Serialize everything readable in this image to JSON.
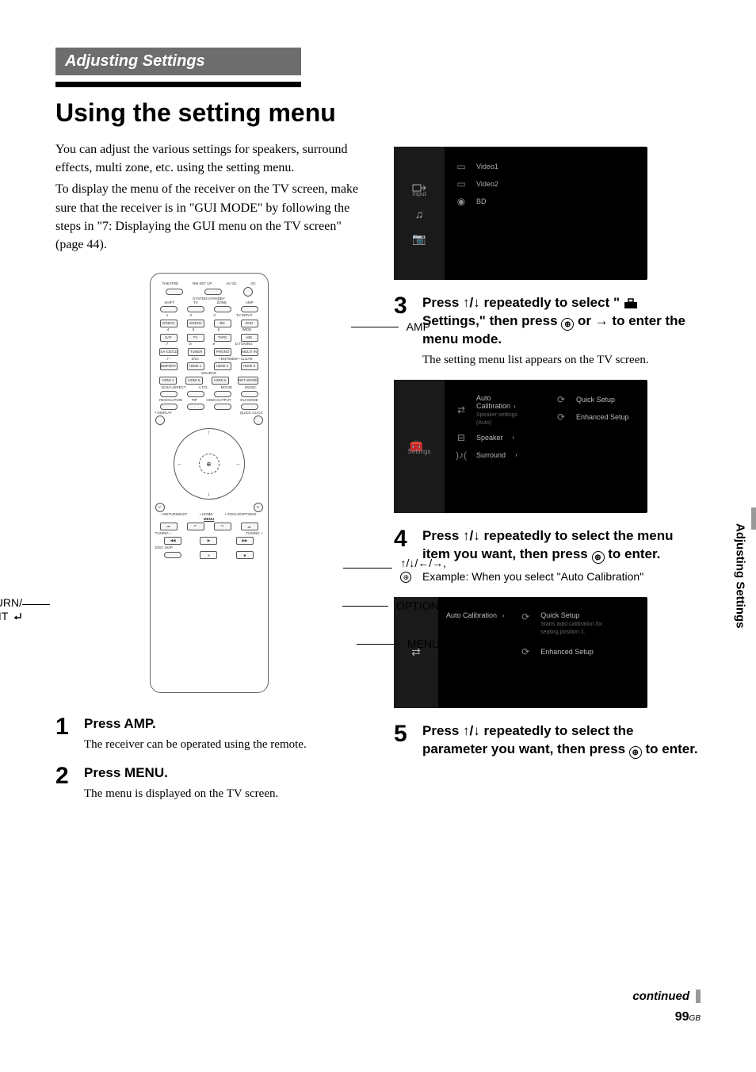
{
  "section_banner": "Adjusting Settings",
  "title": "Using the setting menu",
  "intro": "You can adjust the various settings for speakers, surround effects, multi zone, etc. using the setting menu.",
  "intro2": "To display the menu of the receiver on the TV screen, make sure that the receiver is in \"GUI MODE\" by following the steps in \"7: Displaying the GUI menu on the TV screen\" (page 44).",
  "remote": {
    "top_row": [
      "THEATRE",
      "RM SET UP",
      "AV I/⏻",
      "I/⏻"
    ],
    "system_standby": "SYSTEM STANDBY",
    "mode_row": [
      "SHIFT",
      "TV",
      "ZONE",
      "AMP"
    ],
    "row_num1": [
      ".1",
      ".2",
      ".3"
    ],
    "row_num1_rt": "TV INPUT",
    "rowA": [
      "VIDEO1",
      "VIDEO2",
      "BD"
    ],
    "rowA_rt": "DVD",
    "row_num2": [
      ".4",
      ".5",
      ".6"
    ],
    "row_num2_rt": "WIDE",
    "rowB": [
      "SAT",
      "TV",
      "TAPE"
    ],
    "rowB_rt": "MD",
    "row_num3": [
      ".7",
      ".8",
      ".9"
    ],
    "row_num3_rt": "D.TUNING",
    "rowC": [
      "SA-CD/CD",
      "TUNER",
      "PHONO"
    ],
    "rowC_rt": "MULTI IN",
    "rowD_pre": ".-/--",
    "rowD_center": ".0/10",
    "rowD_label": "• ENT/MEM  • CLEAR",
    "rowE": [
      "DMPORT",
      "HDMI 1",
      "HDMI 2"
    ],
    "rowE_rt": "HDMI 3",
    "source": "SOURCE",
    "rowF": [
      "HDMI 4",
      "HDMI 5",
      "HDMI 6"
    ],
    "rowF_rt": "NET-WORK",
    "rowG": [
      "2CH/A.DIRECT",
      "A.F.D.",
      "MOVIE",
      "MUSIC"
    ],
    "rowH": [
      "RESOLUTION",
      "PIP",
      "HDMI OUTPUT",
      "GUI MODE"
    ],
    "display": "• DISPLAY",
    "quick_click": "QUICK CLICK",
    "below_labels": [
      "• RETURN/EXIT",
      "• HOME",
      "• TOOLS/OPTIONS"
    ],
    "menu_label": "MENU",
    "tuning_minus": "TUNING –",
    "tuning_plus": "TUNING +",
    "disc_skip": "DISC SKIP",
    "callouts": {
      "amp": "AMP",
      "arrows": "↑/↓/←/→,",
      "options": "OPTIONS",
      "menu": "MENU",
      "return1": "RETURN/",
      "return2": "EXIT "
    }
  },
  "steps": {
    "s1": {
      "title": "Press AMP.",
      "text": "The receiver can be operated using the remote."
    },
    "s2": {
      "title": "Press MENU.",
      "text": "The menu is displayed on the TV screen."
    },
    "s3": {
      "title_pre": "Press ",
      "title_arrows": "↑/↓",
      "title_mid": " repeatedly to select \"",
      "title_icon_label": "Settings",
      "title_mid2": ",\" then press ",
      "title_post": " or → to enter the menu mode.",
      "text": "The setting menu list appears on the TV screen."
    },
    "s4": {
      "title_pre": "Press ",
      "title_arrows": "↑/↓",
      "title_mid": " repeatedly to select the menu item you want, then press ",
      "title_post": " to enter."
    },
    "s5": {
      "title_pre": "Press ",
      "title_arrows": "↑/↓",
      "title_mid": " repeatedly to select the parameter you want, then press ",
      "title_post": " to enter."
    }
  },
  "tv1": {
    "sidebar_selected_label": "Input",
    "items": [
      {
        "icon": "▭",
        "label": "Video1"
      },
      {
        "icon": "▭",
        "label": "Video2"
      },
      {
        "icon": "◉",
        "label": "BD"
      }
    ]
  },
  "tv2": {
    "sidebar_label": "Settings",
    "left_items": [
      {
        "icon": "⇄",
        "label": "Auto Calibration",
        "sub": "Speaker settings (Auto)",
        "chev": "›"
      },
      {
        "icon": "⊟",
        "label": "Speaker",
        "chev": "›"
      },
      {
        "icon": "♪",
        "label": "Surround",
        "chev": "›"
      }
    ],
    "right_items": [
      {
        "icon": "⟳",
        "label": "Quick Setup"
      },
      {
        "icon": "⟳",
        "label": "Enhanced Setup"
      }
    ]
  },
  "example_label": "Example: When you select \"Auto Calibration\"",
  "tv3": {
    "left_label": "Auto Calibration",
    "right_items": [
      {
        "icon": "⟳",
        "label": "Quick Setup",
        "sub1": "Starts auto calibration for",
        "sub2": "seating position 1."
      },
      {
        "icon": "⟳",
        "label": "Enhanced Setup"
      }
    ]
  },
  "side_tab": "Adjusting Settings",
  "continued": "continued",
  "pagenum": "99",
  "pagesuffix": "GB"
}
